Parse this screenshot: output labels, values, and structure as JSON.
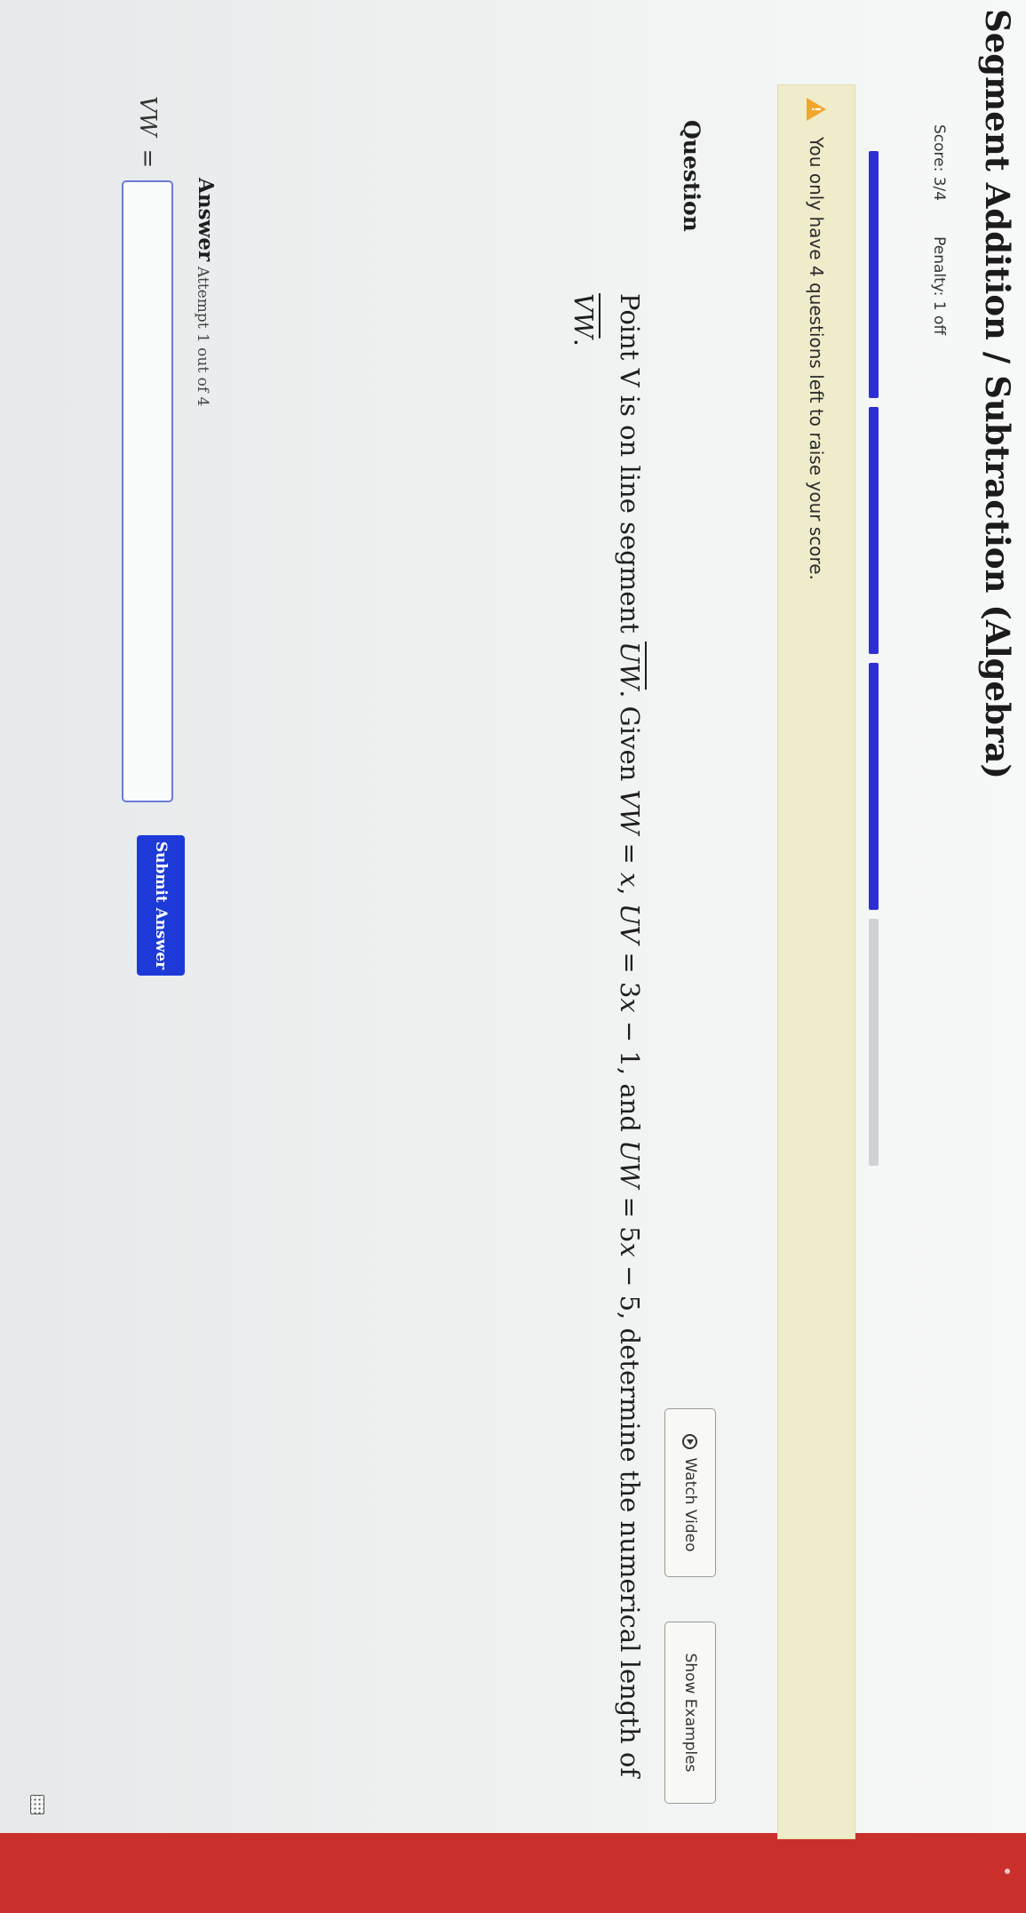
{
  "header": {
    "title": "Segment Addition / Subtraction (Algebra)",
    "score": "Score: 3/4",
    "penalty": "Penalty: 1 off"
  },
  "progress": {
    "segments_total": 4,
    "segments_filled": 3
  },
  "warning": {
    "icon": "warning-triangle-icon",
    "text": "You only have 4 questions left to raise your score."
  },
  "question": {
    "label": "Question",
    "watch_video": "Watch Video",
    "show_examples": "Show Examples",
    "text_parts": {
      "p1": "Point V is on line segment ",
      "uw": "UW",
      "p2": ". Given ",
      "vw1": "VW",
      "p3": " = ",
      "x1": "x",
      "p4": ", ",
      "uv": "UV",
      "p5": " = 3",
      "x2": "x",
      "p6": " − 1, and ",
      "uw2": "UW",
      "p7": " = 5",
      "x3": "x",
      "p8": " − 5, determine the numerical length of ",
      "vw2": "VW",
      "p9": "."
    }
  },
  "answer": {
    "label": "Answer",
    "attempt": "Attempt 1 out of 4",
    "variable": "VW",
    "equals": "=",
    "input_value": "",
    "input_placeholder": "",
    "submit": "Submit Answer"
  },
  "colors": {
    "accent": "#1d3ad8",
    "progress": "#2d2fd4",
    "warning_bg": "#efeccb",
    "warning_icon": "#f1a72c",
    "top_strip": "#c9302c"
  }
}
